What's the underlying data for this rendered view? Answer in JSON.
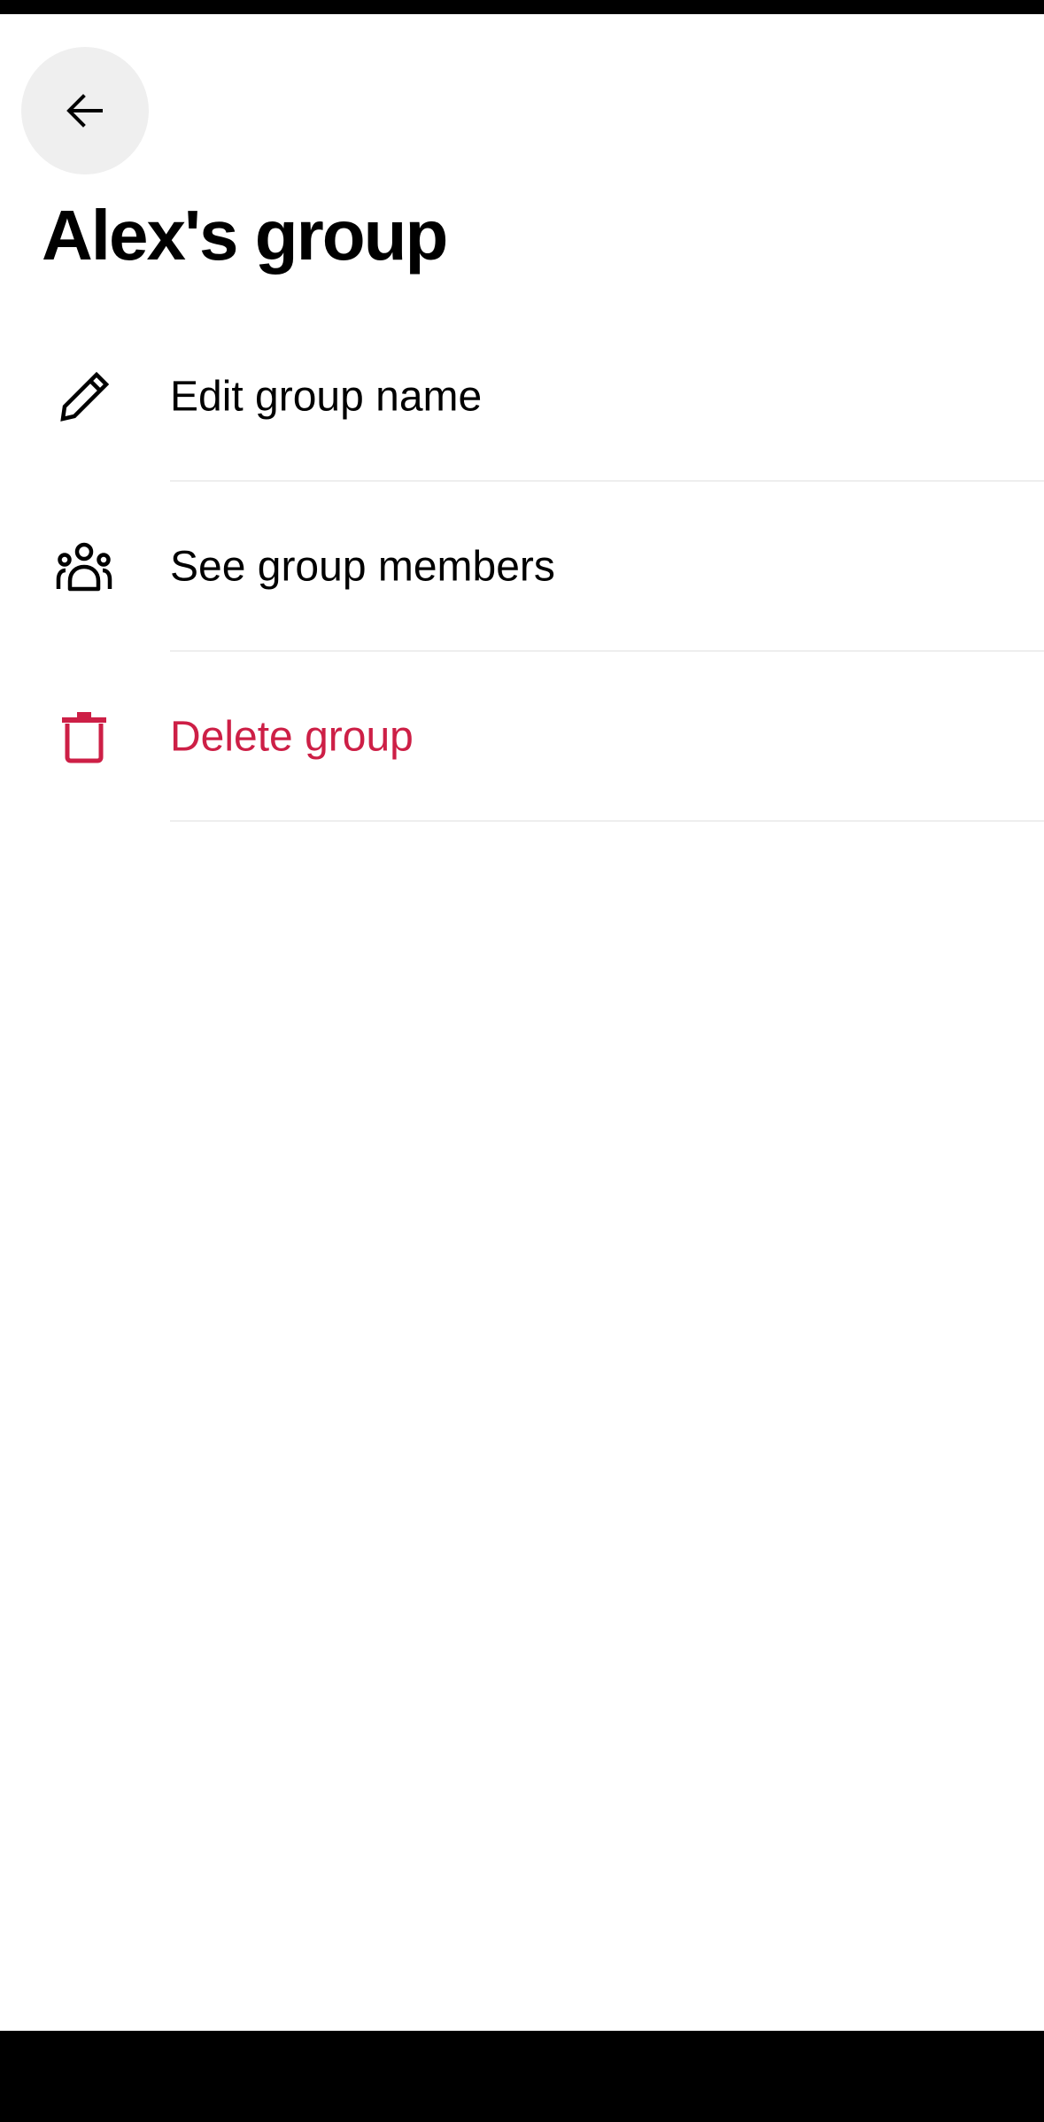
{
  "header": {
    "title": "Alex's group"
  },
  "menu": {
    "items": [
      {
        "label": "Edit group name",
        "icon": "pencil-icon"
      },
      {
        "label": "See group members",
        "icon": "group-members-icon"
      },
      {
        "label": "Delete group",
        "icon": "trash-icon"
      }
    ]
  },
  "colors": {
    "danger": "#cd1f46",
    "back_button_bg": "#efefef",
    "divider": "#eeeeee"
  }
}
